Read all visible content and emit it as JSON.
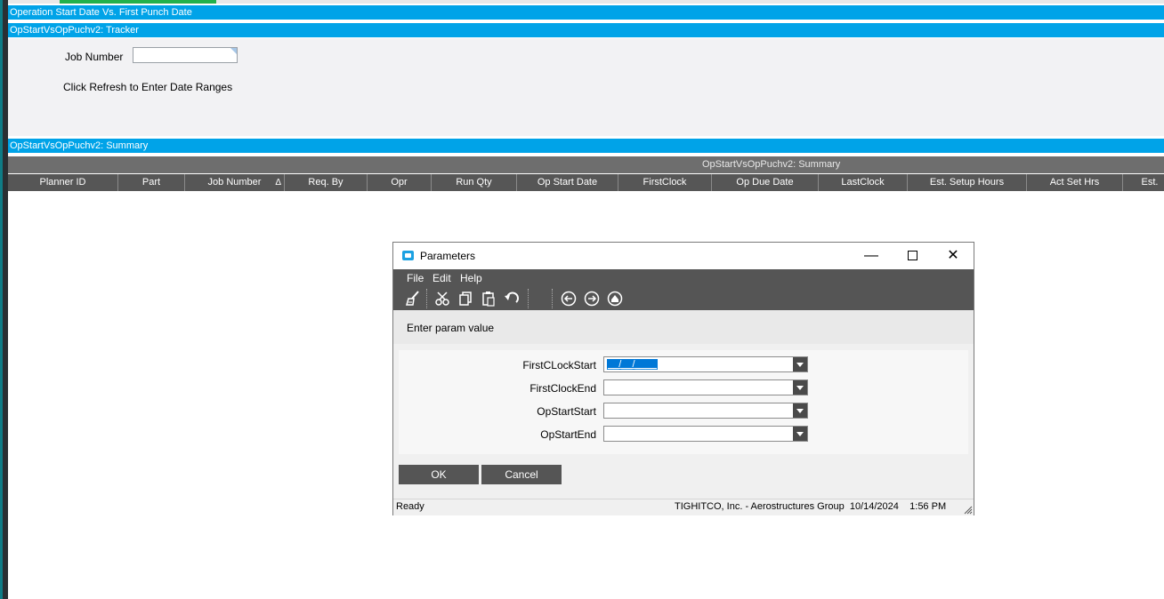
{
  "colors": {
    "section_bar": "#00a3e8",
    "grid_header": "#565656",
    "dialog_bar": "#555555"
  },
  "sections": {
    "main_title": "Operation Start Date Vs. First Punch Date",
    "tracker_title": "OpStartVsOpPuchv2: Tracker",
    "summary_title": "OpStartVsOpPuchv2: Summary"
  },
  "tracker": {
    "job_number_label": "Job Number",
    "job_number_value": "",
    "refresh_hint": "Click Refresh to Enter Date Ranges"
  },
  "grid": {
    "caption": "OpStartVsOpPuchv2: Summary",
    "columns": [
      "Planner ID",
      "Part",
      "Job Number",
      "Req. By",
      "Opr",
      "Run Qty",
      "Op Start Date",
      "FirstClock",
      "Op Due Date",
      "LastClock",
      "Est. Setup Hours",
      "Act Set Hrs",
      "Est."
    ],
    "sort_indicator": "Δ"
  },
  "dialog": {
    "title": "Parameters",
    "window_buttons": {
      "minimize": "—",
      "close": "✕"
    },
    "menu": [
      "File",
      "Edit",
      "Help"
    ],
    "toolbar_icons": [
      "clear-icon",
      "cut-icon",
      "copy-icon",
      "paste-icon",
      "undo-icon",
      "back-icon",
      "forward-icon",
      "home-icon"
    ],
    "instruction": "Enter param value",
    "params": [
      {
        "label": "FirstCLockStart",
        "value": "__/__/____"
      },
      {
        "label": "FirstClockEnd",
        "value": ""
      },
      {
        "label": "OpStartStart",
        "value": ""
      },
      {
        "label": "OpStartEnd",
        "value": ""
      }
    ],
    "ok_label": "OK",
    "cancel_label": "Cancel",
    "status": {
      "state": "Ready",
      "company": "TIGHITCO, Inc. - Aerostructures Group",
      "date": "10/14/2024",
      "time": "1:56 PM"
    }
  }
}
